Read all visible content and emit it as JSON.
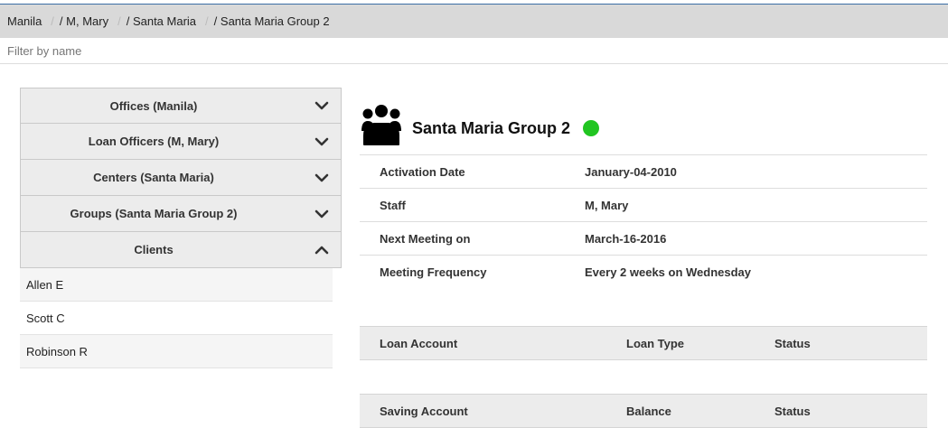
{
  "breadcrumb": {
    "items": [
      "Manila",
      "/ M, Mary",
      "/ Santa Maria",
      "/ Santa Maria Group 2"
    ]
  },
  "filter": {
    "placeholder": "Filter by name",
    "value": ""
  },
  "accordion": {
    "sections": [
      {
        "label": "Offices  (Manila)",
        "icon": "chevron-down-icon"
      },
      {
        "label": "Loan Officers  (M, Mary)",
        "icon": "chevron-down-icon"
      },
      {
        "label": "Centers  (Santa Maria)",
        "icon": "chevron-down-icon"
      },
      {
        "label": "Groups  (Santa Maria Group 2)",
        "icon": "chevron-down-icon"
      },
      {
        "label": "Clients",
        "icon": "chevron-up-icon"
      }
    ],
    "clients": [
      "Allen E",
      "Scott C",
      "Robinson R"
    ]
  },
  "group": {
    "name": "Santa Maria Group 2",
    "icon": "group-icon",
    "status_color": "#21c521"
  },
  "details": [
    {
      "label": "Activation Date",
      "value": "January-04-2010"
    },
    {
      "label": "Staff",
      "value": "M, Mary"
    },
    {
      "label": "Next Meeting on",
      "value": "March-16-2016"
    },
    {
      "label": "Meeting Frequency",
      "value": "Every 2 weeks on Wednesday"
    }
  ],
  "loan_table": {
    "columns": [
      "Loan Account",
      "Loan Type",
      "Status"
    ]
  },
  "saving_table": {
    "columns": [
      "Saving Account",
      "Balance",
      "Status"
    ]
  }
}
